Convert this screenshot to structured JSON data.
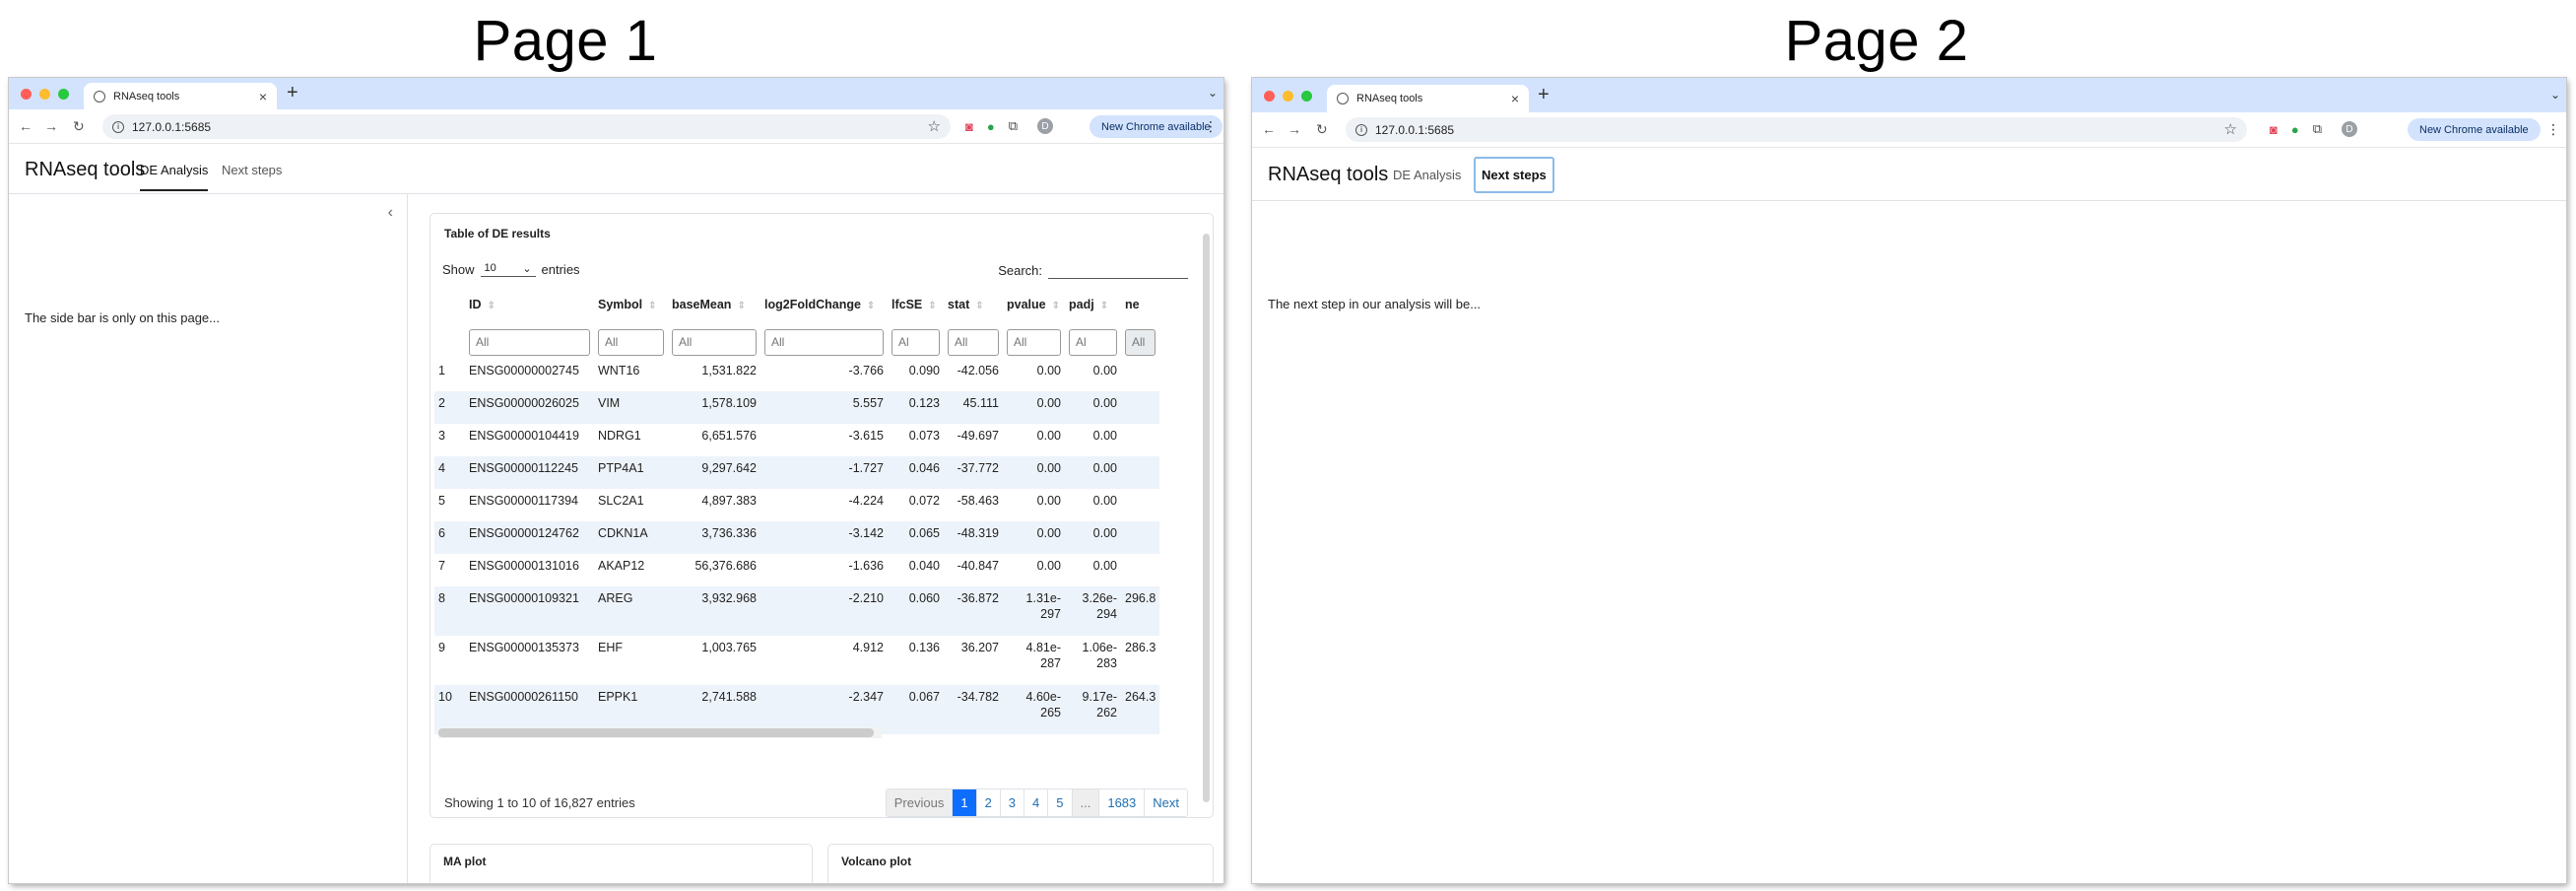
{
  "headings": {
    "page1": "Page 1",
    "page2": "Page 2"
  },
  "browser": {
    "tab_title": "RNAseq tools",
    "url": "127.0.0.1:5685",
    "update_label": "New Chrome available",
    "profile_initial": "D"
  },
  "app": {
    "brand": "RNAseq tools",
    "tabs": [
      "DE Analysis",
      "Next steps"
    ]
  },
  "sidebar": {
    "text": "The side bar is only on this page..."
  },
  "table_card": {
    "title": "Table of DE results",
    "show_label": "Show",
    "entries_value": "10",
    "entries_label": "entries",
    "search_label": "Search:",
    "columns": [
      "ID",
      "Symbol",
      "baseMean",
      "log2FoldChange",
      "lfcSE",
      "stat",
      "pvalue",
      "padj",
      "ne"
    ],
    "filter_placeholders": [
      "All",
      "All",
      "All",
      "All",
      "Al",
      "All",
      "All",
      "Al",
      "All"
    ],
    "rows": [
      [
        "1",
        "ENSG00000002745",
        "WNT16",
        "1,531.822",
        "-3.766",
        "0.090",
        "-42.056",
        "0.00",
        "0.00",
        ""
      ],
      [
        "2",
        "ENSG00000026025",
        "VIM",
        "1,578.109",
        "5.557",
        "0.123",
        "45.111",
        "0.00",
        "0.00",
        ""
      ],
      [
        "3",
        "ENSG00000104419",
        "NDRG1",
        "6,651.576",
        "-3.615",
        "0.073",
        "-49.697",
        "0.00",
        "0.00",
        ""
      ],
      [
        "4",
        "ENSG00000112245",
        "PTP4A1",
        "9,297.642",
        "-1.727",
        "0.046",
        "-37.772",
        "0.00",
        "0.00",
        ""
      ],
      [
        "5",
        "ENSG00000117394",
        "SLC2A1",
        "4,897.383",
        "-4.224",
        "0.072",
        "-58.463",
        "0.00",
        "0.00",
        ""
      ],
      [
        "6",
        "ENSG00000124762",
        "CDKN1A",
        "3,736.336",
        "-3.142",
        "0.065",
        "-48.319",
        "0.00",
        "0.00",
        ""
      ],
      [
        "7",
        "ENSG00000131016",
        "AKAP12",
        "56,376.686",
        "-1.636",
        "0.040",
        "-40.847",
        "0.00",
        "0.00",
        ""
      ],
      [
        "8",
        "ENSG00000109321",
        "AREG",
        "3,932.968",
        "-2.210",
        "0.060",
        "-36.872",
        "1.31e-297",
        "3.26e-294",
        "296.8"
      ],
      [
        "9",
        "ENSG00000135373",
        "EHF",
        "1,003.765",
        "4.912",
        "0.136",
        "36.207",
        "4.81e-287",
        "1.06e-283",
        "286.3"
      ],
      [
        "10",
        "ENSG00000261150",
        "EPPK1",
        "2,741.588",
        "-2.347",
        "0.067",
        "-34.782",
        "4.60e-265",
        "9.17e-262",
        "264.3"
      ]
    ],
    "info": "Showing 1 to 10 of 16,827 entries",
    "pager": [
      "Previous",
      "1",
      "2",
      "3",
      "4",
      "5",
      "...",
      "1683",
      "Next"
    ]
  },
  "plots": {
    "ma_title": "MA plot",
    "volcano_title": "Volcano plot"
  },
  "page2": {
    "text": "The next step in our analysis will be..."
  }
}
